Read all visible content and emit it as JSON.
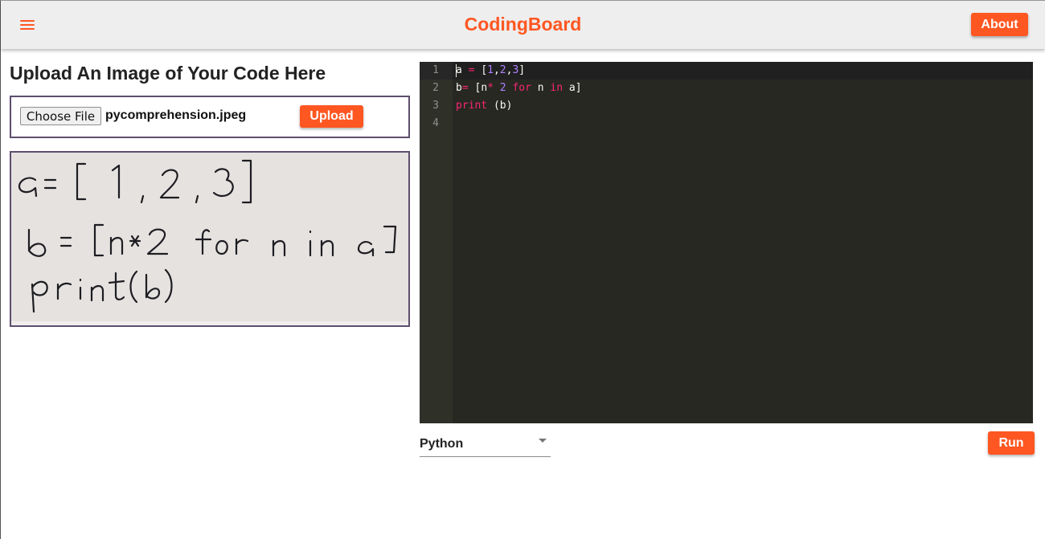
{
  "appbar": {
    "brand": "CodingBoard",
    "about_label": "About",
    "menu_icon": "hamburger-menu-icon"
  },
  "upload": {
    "title": "Upload An Image of Your Code Here",
    "choose_file_label": "Choose File",
    "file_name": "pycomprehension.jpeg",
    "upload_label": "Upload"
  },
  "image": {
    "handwritten_lines": [
      "a=[1,2,3]",
      "b=[n*2 for n in a]",
      "print(b)"
    ]
  },
  "editor": {
    "line_numbers": [
      "1",
      "2",
      "3",
      "4"
    ],
    "lines": [
      "a = [1,2,3]",
      "b= [n* 2 for n in a]",
      "print (b)",
      ""
    ],
    "theme_colors": {
      "background": "#272822",
      "gutter": "#2f3129",
      "text": "#f8f8f2",
      "keyword": "#f92672",
      "number": "#ae81ff"
    }
  },
  "language": {
    "selected": "Python"
  },
  "run_label": "Run",
  "colors": {
    "accent": "#ff5722",
    "appbar_bg": "#eeeeee",
    "box_border": "#5d4e6d"
  }
}
